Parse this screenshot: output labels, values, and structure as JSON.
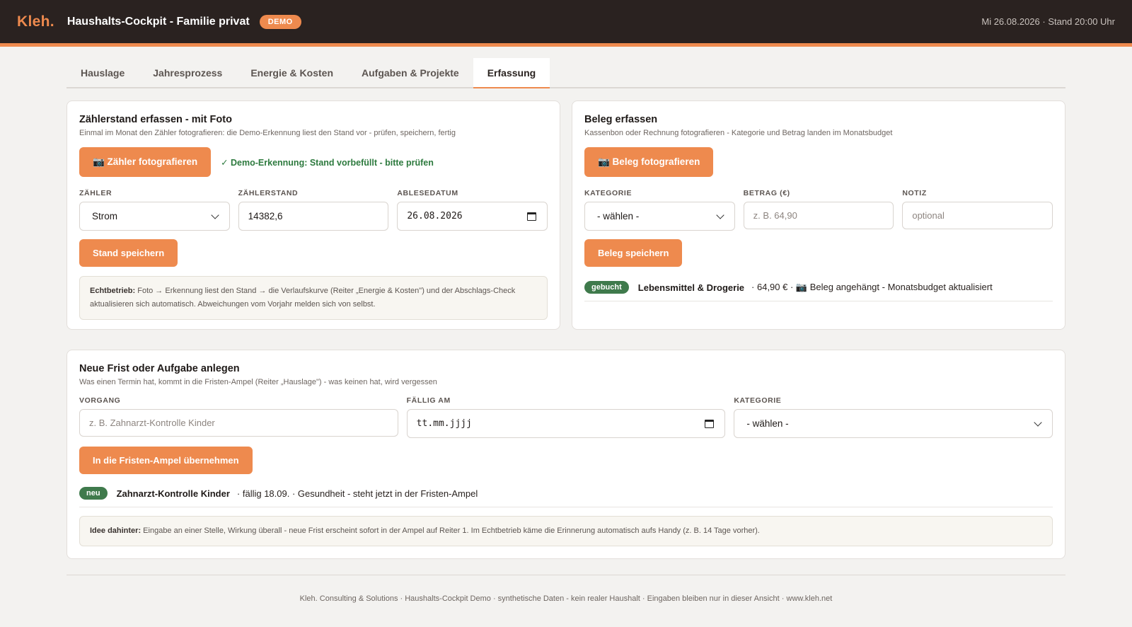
{
  "header": {
    "logo": "Kleh.",
    "title": "Haushalts-Cockpit - Familie privat",
    "badge": "DEMO",
    "timestamp": "Mi 26.08.2026 · Stand 20:00 Uhr"
  },
  "tabs": [
    {
      "label": "Hauslage"
    },
    {
      "label": "Jahresprozess"
    },
    {
      "label": "Energie & Kosten"
    },
    {
      "label": "Aufgaben & Projekte"
    },
    {
      "label": "Erfassung"
    }
  ],
  "meter": {
    "title": "Zählerstand erfassen - mit Foto",
    "subtitle": "Einmal im Monat den Zähler fotografieren: die Demo-Erkennung liest den Stand vor - prüfen, speichern, fertig",
    "photo_button": "📷 Zähler fotografieren",
    "recognition_msg": "✓ Demo-Erkennung: Stand vorbefüllt - bitte prüfen",
    "fields": {
      "meter_label": "ZÄHLER",
      "meter_value": "Strom",
      "reading_label": "ZÄHLERSTAND",
      "reading_value": "14382,6",
      "date_label": "ABLESEDATUM",
      "date_value": "26.08.2026"
    },
    "save_button": "Stand speichern",
    "note_bold": "Echtbetrieb:",
    "note_text": " Foto → Erkennung liest den Stand → die Verlaufskurve (Reiter „Energie & Kosten\") und der Abschlags-Check aktualisieren sich automatisch. Abweichungen vom Vorjahr melden sich von selbst."
  },
  "receipt": {
    "title": "Beleg erfassen",
    "subtitle": "Kassenbon oder Rechnung fotografieren - Kategorie und Betrag landen im Monatsbudget",
    "photo_button": "📷 Beleg fotografieren",
    "fields": {
      "category_label": "KATEGORIE",
      "category_value": "- wählen -",
      "amount_label": "BETRAG (€)",
      "amount_placeholder": "z. B. 64,90",
      "note_label": "NOTIZ",
      "note_placeholder": "optional"
    },
    "save_button": "Beleg speichern",
    "result": {
      "badge": "gebucht",
      "name": "Lebensmittel & Drogerie",
      "details": "· 64,90 € · 📷 Beleg angehängt - Monatsbudget aktualisiert"
    }
  },
  "task": {
    "title": "Neue Frist oder Aufgabe anlegen",
    "subtitle": "Was einen Termin hat, kommt in die Fristen-Ampel (Reiter „Hauslage\") - was keinen hat, wird vergessen",
    "fields": {
      "process_label": "VORGANG",
      "process_placeholder": "z. B. Zahnarzt-Kontrolle Kinder",
      "due_label": "FÄLLIG AM",
      "due_value": "tt.mm.jjjj",
      "category_label": "KATEGORIE",
      "category_value": "- wählen -"
    },
    "save_button": "In die Fristen-Ampel übernehmen",
    "result": {
      "badge": "neu",
      "name": "Zahnarzt-Kontrolle Kinder",
      "details": "· fällig 18.09. · Gesundheit - steht jetzt in der Fristen-Ampel"
    },
    "note_bold": "Idee dahinter:",
    "note_text": " Eingabe an einer Stelle, Wirkung überall - neue Frist erscheint sofort in der Ampel auf Reiter 1. Im Echtbetrieb käme die Erinnerung automatisch aufs Handy (z. B. 14 Tage vorher)."
  },
  "footer": "Kleh. Consulting & Solutions · Haushalts-Cockpit Demo · synthetische Daten - kein realer Haushalt · Eingaben bleiben nur in dieser Ansicht · www.kleh.net"
}
